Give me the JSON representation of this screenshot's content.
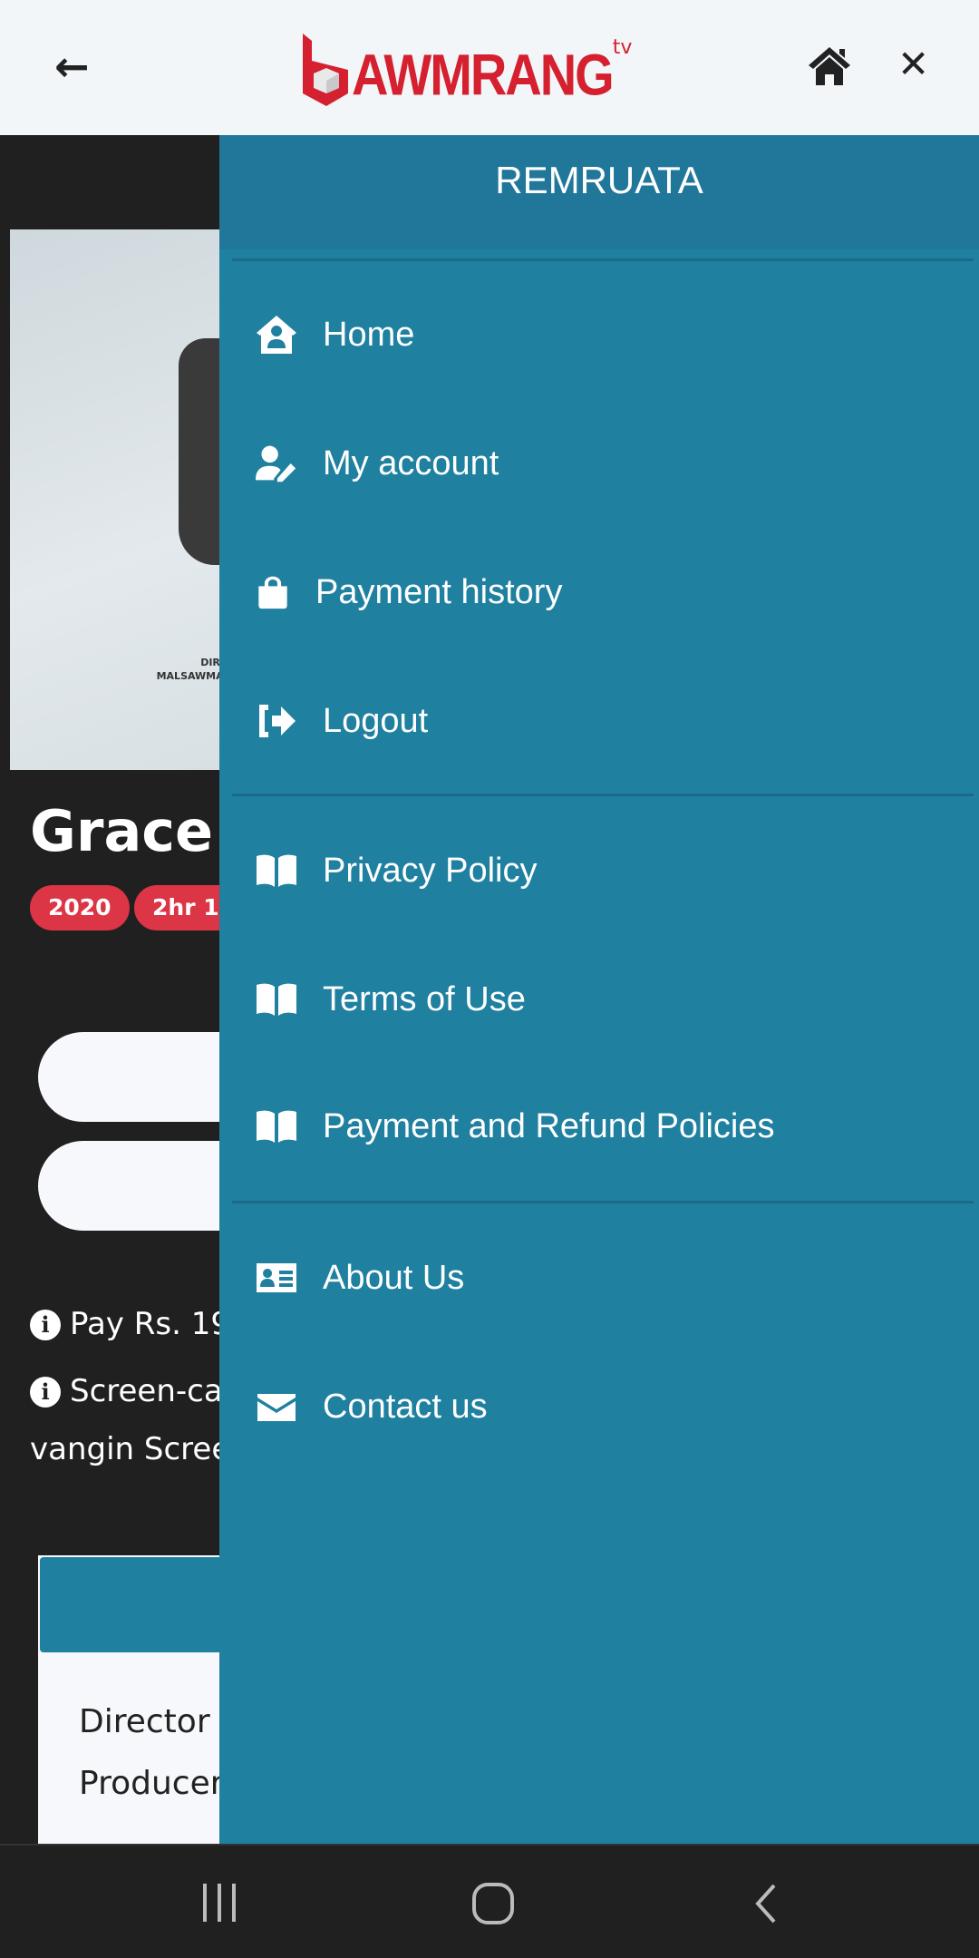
{
  "topbar": {
    "brand": "AWMRANG",
    "brand_suffix": "tv",
    "brand_color": "#d4202f",
    "icons": [
      "back-arrow-icon",
      "home-icon",
      "close-icon"
    ]
  },
  "movie": {
    "title": "Grace",
    "badges": [
      "2020",
      "2hr 1"
    ],
    "info": [
      "Pay Rs. 19",
      "Screen-ca",
      "vangin Scree"
    ],
    "credits": [
      "Director",
      "Producer"
    ],
    "poster_credit": [
      "DIRECT",
      "MALSAWMA PA"
    ]
  },
  "drawer": {
    "username": "REMRUATA",
    "bg_color": "#1f80a0",
    "items": [
      {
        "label": "Home",
        "icon": "user-house-icon"
      },
      {
        "label": "My account",
        "icon": "user-pen-icon"
      },
      {
        "label": "Payment history",
        "icon": "shopping-bag-icon"
      },
      {
        "label": "Logout",
        "icon": "sign-out-icon"
      },
      {
        "label": "Privacy Policy",
        "icon": "book-open-icon"
      },
      {
        "label": "Terms of Use",
        "icon": "book-open-icon"
      },
      {
        "label": "Payment and Refund Policies",
        "icon": "book-open-icon"
      },
      {
        "label": "About Us",
        "icon": "id-card-icon"
      },
      {
        "label": "Contact us",
        "icon": "envelope-icon"
      }
    ]
  },
  "navbar": {
    "icons": [
      "recent-apps-icon",
      "home-circle-icon",
      "back-chevron-icon"
    ]
  }
}
